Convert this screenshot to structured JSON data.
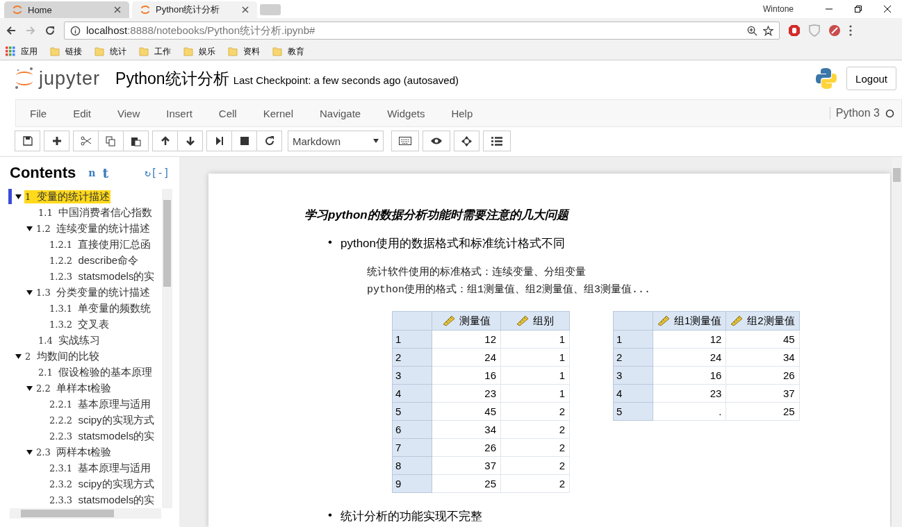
{
  "browser": {
    "tabs": [
      {
        "label": "Home",
        "selected": false
      },
      {
        "label": "Python统计分析",
        "selected": true
      }
    ],
    "url_host": "localhost",
    "url_path": ":8888/notebooks/Python统计分析.ipynb#",
    "user": "Wintone",
    "bookmarks": [
      {
        "label": "应用",
        "kind": "apps"
      },
      {
        "label": "链接",
        "kind": "folder"
      },
      {
        "label": "统计",
        "kind": "folder"
      },
      {
        "label": "工作",
        "kind": "folder"
      },
      {
        "label": "娱乐",
        "kind": "folder"
      },
      {
        "label": "资料",
        "kind": "folder"
      },
      {
        "label": "教育",
        "kind": "folder"
      }
    ]
  },
  "notebook": {
    "logo_text": "jupyter",
    "title": "Python统计分析",
    "checkpoint": "Last Checkpoint: a few seconds ago (autosaved)",
    "logout": "Logout",
    "menu": [
      "File",
      "Edit",
      "View",
      "Insert",
      "Cell",
      "Kernel",
      "Navigate",
      "Widgets",
      "Help"
    ],
    "kernel": "Python 3",
    "cell_type": "Markdown"
  },
  "toc": {
    "title": "Contents",
    "toggle_n": "n",
    "toggle_t": "t",
    "refresh": "↻",
    "collapse": "[-]",
    "items": [
      {
        "number": "1",
        "title": "变量的统计描述",
        "selected": true,
        "expanded": true,
        "children": [
          {
            "number": "1.1",
            "title": "中国消费者信心指数",
            "selected": false
          },
          {
            "number": "1.2",
            "title": "连续变量的统计描述",
            "selected": false,
            "expanded": true,
            "children": [
              {
                "number": "1.2.1",
                "title": "直接使用汇总函",
                "selected": false
              },
              {
                "number": "1.2.2",
                "title": "describe命令",
                "selected": false
              },
              {
                "number": "1.2.3",
                "title": "statsmodels的实",
                "selected": false
              }
            ]
          },
          {
            "number": "1.3",
            "title": "分类变量的统计描述",
            "selected": false,
            "expanded": true,
            "children": [
              {
                "number": "1.3.1",
                "title": "单变量的频数统",
                "selected": false
              },
              {
                "number": "1.3.2",
                "title": "交叉表",
                "selected": false
              }
            ]
          },
          {
            "number": "1.4",
            "title": "实战练习",
            "selected": false
          }
        ]
      },
      {
        "number": "2",
        "title": "均数间的比较",
        "selected": false,
        "expanded": true,
        "children": [
          {
            "number": "2.1",
            "title": "假设检验的基本原理",
            "selected": false
          },
          {
            "number": "2.2",
            "title": "单样本t检验",
            "selected": false,
            "expanded": true,
            "children": [
              {
                "number": "2.2.1",
                "title": "基本原理与适用",
                "selected": false
              },
              {
                "number": "2.2.2",
                "title": "scipy的实现方式",
                "selected": false
              },
              {
                "number": "2.2.3",
                "title": "statsmodels的实",
                "selected": false
              }
            ]
          },
          {
            "number": "2.3",
            "title": "两样本t检验",
            "selected": false,
            "expanded": true,
            "children": [
              {
                "number": "2.3.1",
                "title": "基本原理与适用",
                "selected": false
              },
              {
                "number": "2.3.2",
                "title": "scipy的实现方式",
                "selected": false
              },
              {
                "number": "2.3.3",
                "title": "statsmodels的实",
                "selected": false
              }
            ]
          }
        ]
      }
    ]
  },
  "cell": {
    "heading": "学习python的数据分析功能时需要注意的几大问题",
    "bullet_1": {
      "marker": "•",
      "text": "python使用的数据格式和标准统计格式不同"
    },
    "code_lines": [
      "统计软件使用的标准格式：连续变量、分组变量",
      "python使用的格式：组1测量值、组2测量值、组3测量值..."
    ],
    "tables": [
      {
        "columns": [
          "",
          "测量值",
          "组别"
        ],
        "rows": [
          [
            "1",
            "12",
            "1"
          ],
          [
            "2",
            "24",
            "1"
          ],
          [
            "3",
            "16",
            "1"
          ],
          [
            "4",
            "23",
            "1"
          ],
          [
            "5",
            "45",
            "2"
          ],
          [
            "6",
            "34",
            "2"
          ],
          [
            "7",
            "26",
            "2"
          ],
          [
            "8",
            "37",
            "2"
          ],
          [
            "9",
            "25",
            "2"
          ]
        ]
      },
      {
        "columns": [
          "",
          "组1测量值",
          "组2测量值"
        ],
        "rows": [
          [
            "1",
            "12",
            "45"
          ],
          [
            "2",
            "24",
            "34"
          ],
          [
            "3",
            "16",
            "26"
          ],
          [
            "4",
            "23",
            "37"
          ],
          [
            "5",
            ".",
            "25"
          ]
        ]
      }
    ],
    "bullet_2": {
      "marker": "•",
      "text": "统计分析的功能实现不完整"
    }
  }
}
